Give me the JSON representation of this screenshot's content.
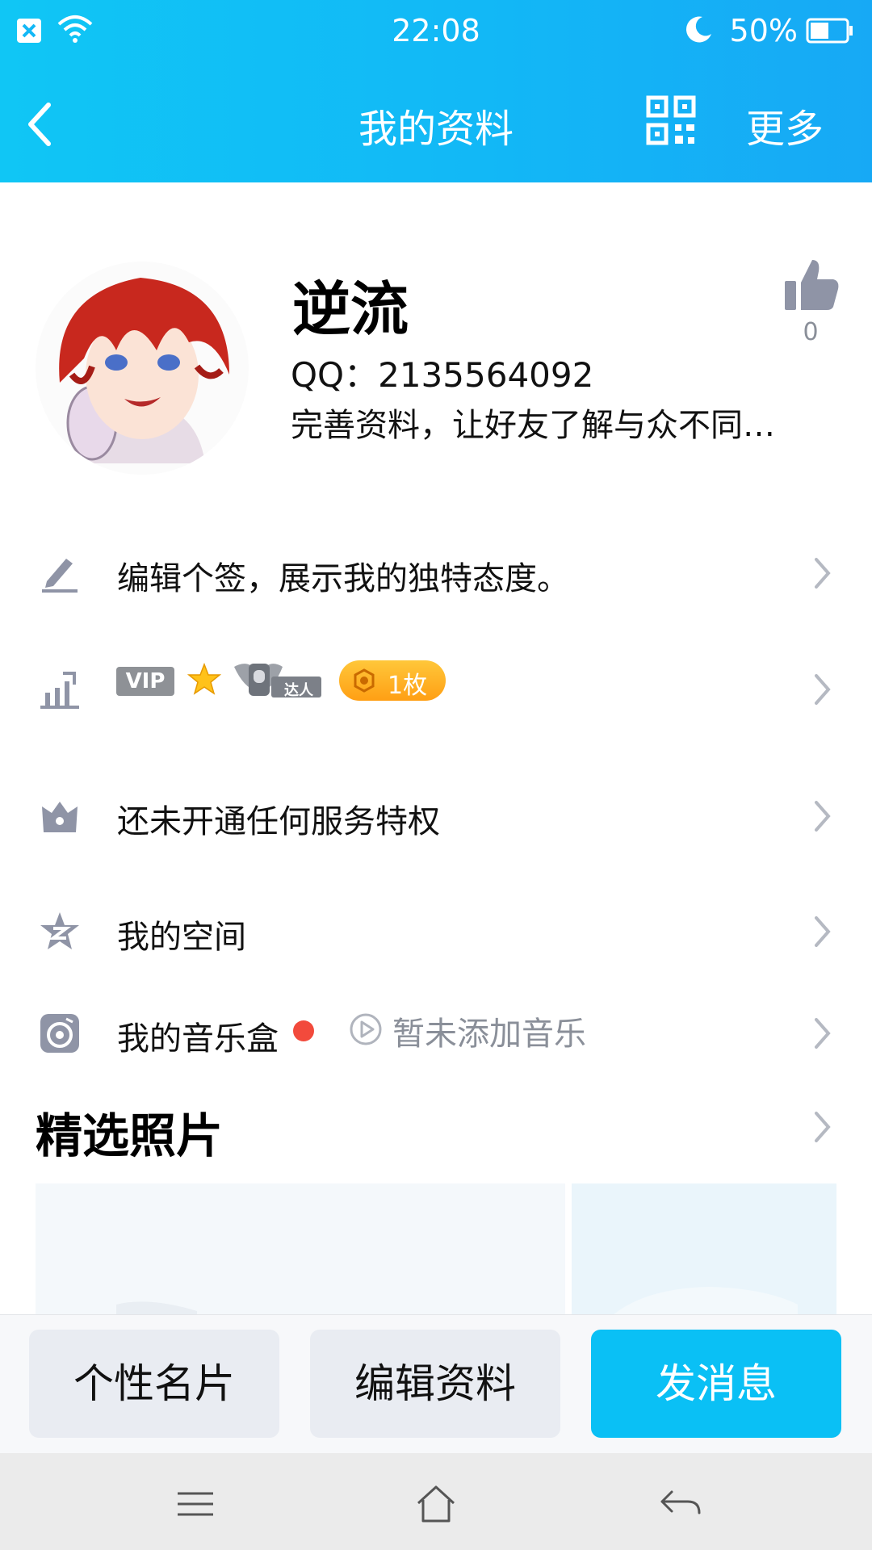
{
  "status_bar": {
    "time": "22:08",
    "battery": "50%"
  },
  "nav": {
    "title": "我的资料",
    "more": "更多"
  },
  "profile": {
    "nickname": "逆流",
    "qq": "QQ：2135564092",
    "intro": "完善资料，让好友了解与众不同…",
    "likes": "0"
  },
  "rows": {
    "signature": "编辑个签，展示我的独特态度。",
    "vip_badge": "VIP",
    "daren_badge": "达人",
    "coin_badge": "1枚",
    "service": "还未开通任何服务特权",
    "space": "我的空间",
    "music": "我的音乐盒",
    "music_empty": "暂未添加音乐"
  },
  "photos_section": {
    "title": "精选照片"
  },
  "bottom_bar": {
    "card": "个性名片",
    "edit": "编辑资料",
    "message": "发消息"
  },
  "colors": {
    "header": "#12b8f6",
    "primary_button": "#0ac0f5",
    "red_dot": "#f24a3c",
    "coin_badge": "#ffb020"
  }
}
